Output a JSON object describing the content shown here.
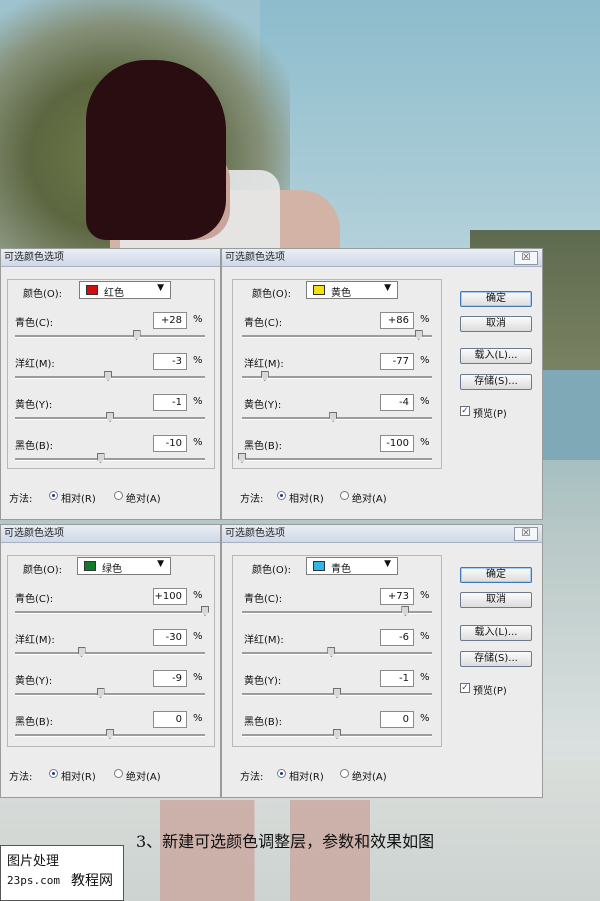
{
  "dialogs": [
    {
      "title": "可选颜色选项",
      "color_label": "颜色(O):",
      "color_name": "红色",
      "color_hex": "#d01010",
      "sliders": [
        {
          "label": "青色(C):",
          "value": "+28",
          "unit": "%",
          "level": 0.64
        },
        {
          "label": "洋红(M):",
          "value": "-3",
          "unit": "%",
          "level": 0.49
        },
        {
          "label": "黄色(Y):",
          "value": "-1",
          "unit": "%",
          "level": 0.5
        },
        {
          "label": "黑色(B):",
          "value": "-10",
          "unit": "%",
          "level": 0.45
        }
      ],
      "method_label": "方法:",
      "method_relative": "相对(R)",
      "method_absolute": "绝对(A)"
    },
    {
      "title": "可选颜色选项",
      "close_label": "☒",
      "color_label": "颜色(O):",
      "color_name": "黄色",
      "color_hex": "#f2e10a",
      "sliders": [
        {
          "label": "青色(C):",
          "value": "+86",
          "unit": "%",
          "level": 0.93
        },
        {
          "label": "洋红(M):",
          "value": "-77",
          "unit": "%",
          "level": 0.12
        },
        {
          "label": "黄色(Y):",
          "value": "-4",
          "unit": "%",
          "level": 0.48
        },
        {
          "label": "黑色(B):",
          "value": "-100",
          "unit": "%",
          "level": 0.0
        }
      ],
      "method_label": "方法:",
      "method_relative": "相对(R)",
      "method_absolute": "绝对(A)",
      "buttons": {
        "ok": "确定",
        "cancel": "取消",
        "load": "载入(L)...",
        "save": "存储(S)...",
        "preview": "预览(P)"
      }
    },
    {
      "title": "可选颜色选项",
      "color_label": "颜色(O):",
      "color_name": "绿色",
      "color_hex": "#127b2a",
      "sliders": [
        {
          "label": "青色(C):",
          "value": "+100",
          "unit": "%",
          "level": 1.0
        },
        {
          "label": "洋红(M):",
          "value": "-30",
          "unit": "%",
          "level": 0.35
        },
        {
          "label": "黄色(Y):",
          "value": "-9",
          "unit": "%",
          "level": 0.45
        },
        {
          "label": "黑色(B):",
          "value": "0",
          "unit": "%",
          "level": 0.5
        }
      ],
      "method_label": "方法:",
      "method_relative": "相对(R)",
      "method_absolute": "绝对(A)"
    },
    {
      "title": "可选颜色选项",
      "close_label": "☒",
      "color_label": "颜色(O):",
      "color_name": "青色",
      "color_hex": "#31b7e6",
      "sliders": [
        {
          "label": "青色(C):",
          "value": "+73",
          "unit": "%",
          "level": 0.86
        },
        {
          "label": "洋红(M):",
          "value": "-6",
          "unit": "%",
          "level": 0.47
        },
        {
          "label": "黄色(Y):",
          "value": "-1",
          "unit": "%",
          "level": 0.5
        },
        {
          "label": "黑色(B):",
          "value": "0",
          "unit": "%",
          "level": 0.5
        }
      ],
      "method_label": "方法:",
      "method_relative": "相对(R)",
      "method_absolute": "绝对(A)",
      "buttons": {
        "ok": "确定",
        "cancel": "取消",
        "load": "载入(L)...",
        "save": "存储(S)...",
        "preview": "预览(P)"
      }
    }
  ],
  "caption": "3、新建可选颜色调整层，参数和效果如图",
  "watermark": {
    "line1": "图片处理",
    "line2": "23ps.com",
    "line3": "教程网"
  }
}
